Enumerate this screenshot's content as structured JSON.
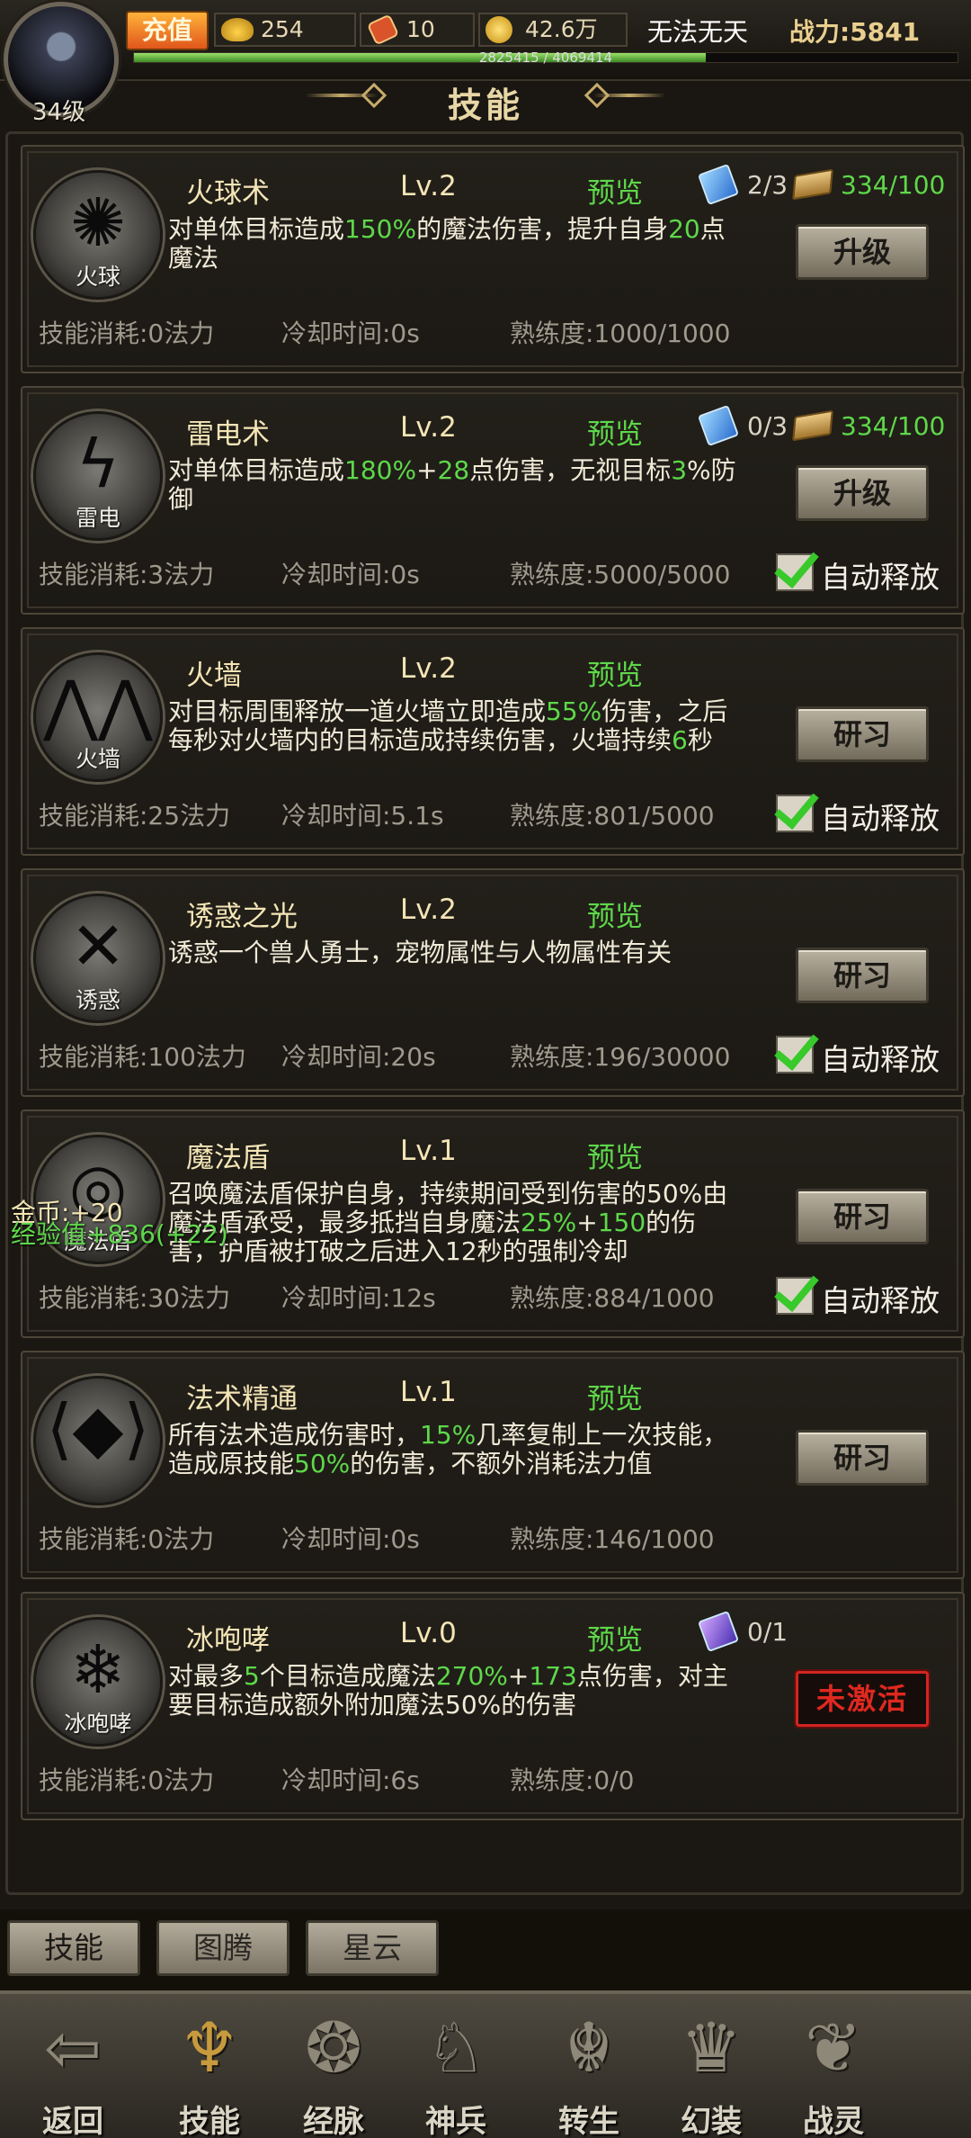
{
  "player": {
    "level": "34级",
    "recharge": "充值",
    "ingot": "254",
    "ticket": "10",
    "gold": "42.6万",
    "title": "无法无天",
    "power": "战力:5841",
    "exp_text": "2825415 / 4069414",
    "exp_fraction": 0.694
  },
  "header": {
    "title": "技能"
  },
  "skills": [
    {
      "icon_label": "火球",
      "icon_glyph": "✺",
      "name": "火球术",
      "level": "Lv.2",
      "preview": "预览",
      "desc": [
        {
          "t": "对单体目标造成"
        },
        {
          "t": "150%",
          "g": true
        },
        {
          "t": "的魔法伤害，提升自身"
        },
        {
          "t": "20",
          "g": true
        },
        {
          "t": "点魔法"
        }
      ],
      "cost": "技能消耗:0法力",
      "cooldown": "冷却时间:0s",
      "mastery": "熟练度:1000/1000",
      "book_count": "2/3",
      "scroll_count": "334/100",
      "button": "升级",
      "auto": ""
    },
    {
      "icon_label": "雷电",
      "icon_glyph": "ϟ",
      "name": "雷电术",
      "level": "Lv.2",
      "preview": "预览",
      "desc": [
        {
          "t": "对单体目标造成"
        },
        {
          "t": "180%",
          "g": true
        },
        {
          "t": "+"
        },
        {
          "t": "28",
          "g": true
        },
        {
          "t": "点伤害，无视目标"
        },
        {
          "t": "3",
          "g": true
        },
        {
          "t": "%防御"
        }
      ],
      "cost": "技能消耗:3法力",
      "cooldown": "冷却时间:0s",
      "mastery": "熟练度:5000/5000",
      "book_count": "0/3",
      "scroll_count": "334/100",
      "button": "升级",
      "auto": "自动释放"
    },
    {
      "icon_label": "火墙",
      "icon_glyph": "⋀⋀",
      "name": "火墙",
      "level": "Lv.2",
      "preview": "预览",
      "desc": [
        {
          "t": "对目标周围释放一道火墙立即造成"
        },
        {
          "t": "55%",
          "g": true
        },
        {
          "t": "伤害，之后每秒对火墙内的目标造成持续伤害，火墙持续"
        },
        {
          "t": "6",
          "g": true
        },
        {
          "t": "秒"
        }
      ],
      "cost": "技能消耗:25法力",
      "cooldown": "冷却时间:5.1s",
      "mastery": "熟练度:801/5000",
      "book_count": "",
      "scroll_count": "",
      "button": "研习",
      "auto": "自动释放"
    },
    {
      "icon_label": "诱惑",
      "icon_glyph": "✕",
      "name": "诱惑之光",
      "level": "Lv.2",
      "preview": "预览",
      "desc": [
        {
          "t": "诱惑一个兽人勇士，宠物属性与人物属性有关"
        }
      ],
      "cost": "技能消耗:100法力",
      "cooldown": "冷却时间:20s",
      "mastery": "熟练度:196/30000",
      "book_count": "",
      "scroll_count": "",
      "button": "研习",
      "auto": "自动释放"
    },
    {
      "icon_label": "魔法盾",
      "icon_glyph": "◎",
      "name": "魔法盾",
      "level": "Lv.1",
      "preview": "预览",
      "desc": [
        {
          "t": "召唤魔法盾保护自身，持续期间受到伤害的50%由魔法盾承受，最多抵挡自身魔法"
        },
        {
          "t": "25%",
          "g": true
        },
        {
          "t": "+"
        },
        {
          "t": "150",
          "g": true
        },
        {
          "t": "的伤害，护盾被打破之后进入12秒的强制冷却"
        }
      ],
      "cost": "技能消耗:30法力",
      "cooldown": "冷却时间:12s",
      "mastery": "熟练度:884/1000",
      "book_count": "",
      "scroll_count": "",
      "button": "研习",
      "auto": "自动释放"
    },
    {
      "icon_label": "",
      "icon_glyph": "⟨◆⟩",
      "name": "法术精通",
      "level": "Lv.1",
      "preview": "预览",
      "desc": [
        {
          "t": "所有法术造成伤害时，"
        },
        {
          "t": "15%",
          "g": true
        },
        {
          "t": "几率复制上一次技能，造成原技能"
        },
        {
          "t": "50%",
          "g": true
        },
        {
          "t": "的伤害，不额外消耗法力值"
        }
      ],
      "cost": "技能消耗:0法力",
      "cooldown": "冷却时间:0s",
      "mastery": "熟练度:146/1000",
      "book_count": "",
      "scroll_count": "",
      "button": "研习",
      "auto": ""
    },
    {
      "icon_label": "冰咆哮",
      "icon_glyph": "❄",
      "name": "冰咆哮",
      "level": "Lv.0",
      "preview": "预览",
      "desc": [
        {
          "t": "对最多"
        },
        {
          "t": "5",
          "g": true
        },
        {
          "t": "个目标造成魔法"
        },
        {
          "t": "270%",
          "g": true
        },
        {
          "t": "+"
        },
        {
          "t": "173",
          "g": true
        },
        {
          "t": "点伤害，对主要目标造成额外附加魔法50%的伤害"
        }
      ],
      "cost": "技能消耗:0法力",
      "cooldown": "冷却时间:6s",
      "mastery": "熟练度:0/0",
      "book_count": "0/1",
      "scroll_count": "",
      "button": "未激活",
      "auto": ""
    }
  ],
  "floating": {
    "gold_gain": "金币:+20",
    "exp_gain": "经验值+836(+22)"
  },
  "tabs": [
    "技能",
    "图腾",
    "星云"
  ],
  "nav": [
    {
      "label": "返回",
      "icon": "back-arrow-icon",
      "glyph": "⇦"
    },
    {
      "label": "技能",
      "icon": "skill-emblem-icon",
      "glyph": "♆"
    },
    {
      "label": "经脉",
      "icon": "meridian-icon",
      "glyph": "❂"
    },
    {
      "label": "神兵",
      "icon": "divine-weapon-icon",
      "glyph": "♘"
    },
    {
      "label": "转生",
      "icon": "rebirth-icon",
      "glyph": "☬"
    },
    {
      "label": "幻装",
      "icon": "phantom-gear-icon",
      "glyph": "♛"
    },
    {
      "label": "战灵",
      "icon": "war-spirit-icon",
      "glyph": "❦"
    }
  ]
}
